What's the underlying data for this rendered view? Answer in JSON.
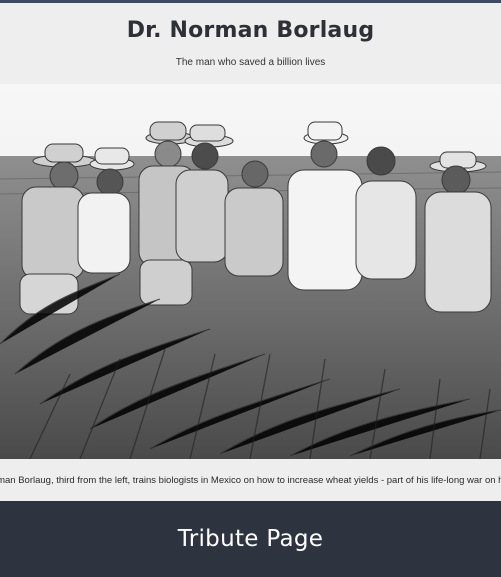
{
  "header": {
    "title": "Dr. Norman Borlaug",
    "subtitle": "The man who saved a billion lives"
  },
  "figure": {
    "caption": "Dr. Norman Borlaug, third from the left, trains biologists in Mexico on how to increase wheat yields - part of his life-long war on hunger."
  },
  "footer": {
    "label": "Tribute Page"
  },
  "colors": {
    "top_border": "#3c4a63",
    "background": "#eeeeee",
    "footer_bg": "#2d3440"
  }
}
